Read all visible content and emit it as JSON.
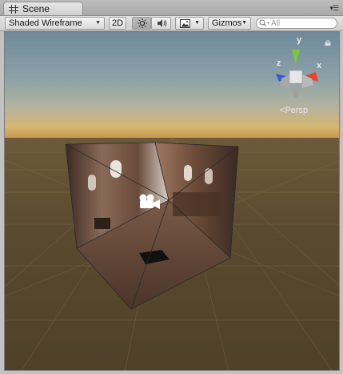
{
  "tab": {
    "title": "Scene",
    "icon": "scene-hash-icon"
  },
  "toolbar": {
    "draw_mode": "Shaded Wireframe",
    "mode_2d": "2D",
    "lighting_icon": "sun-icon",
    "audio_icon": "speaker-icon",
    "effects_icon": "image-icon",
    "gizmos_label": "Gizmos",
    "search_placeholder": "All"
  },
  "gizmo": {
    "axis_y": "y",
    "axis_x": "x",
    "axis_z": "z",
    "projection_label": "Persp",
    "colors": {
      "x": "#e8412d",
      "y": "#7ec83a",
      "z": "#2f5fd6"
    }
  },
  "scene": {
    "camera_icon": "camera-icon",
    "lock_icon": "lock-icon"
  }
}
